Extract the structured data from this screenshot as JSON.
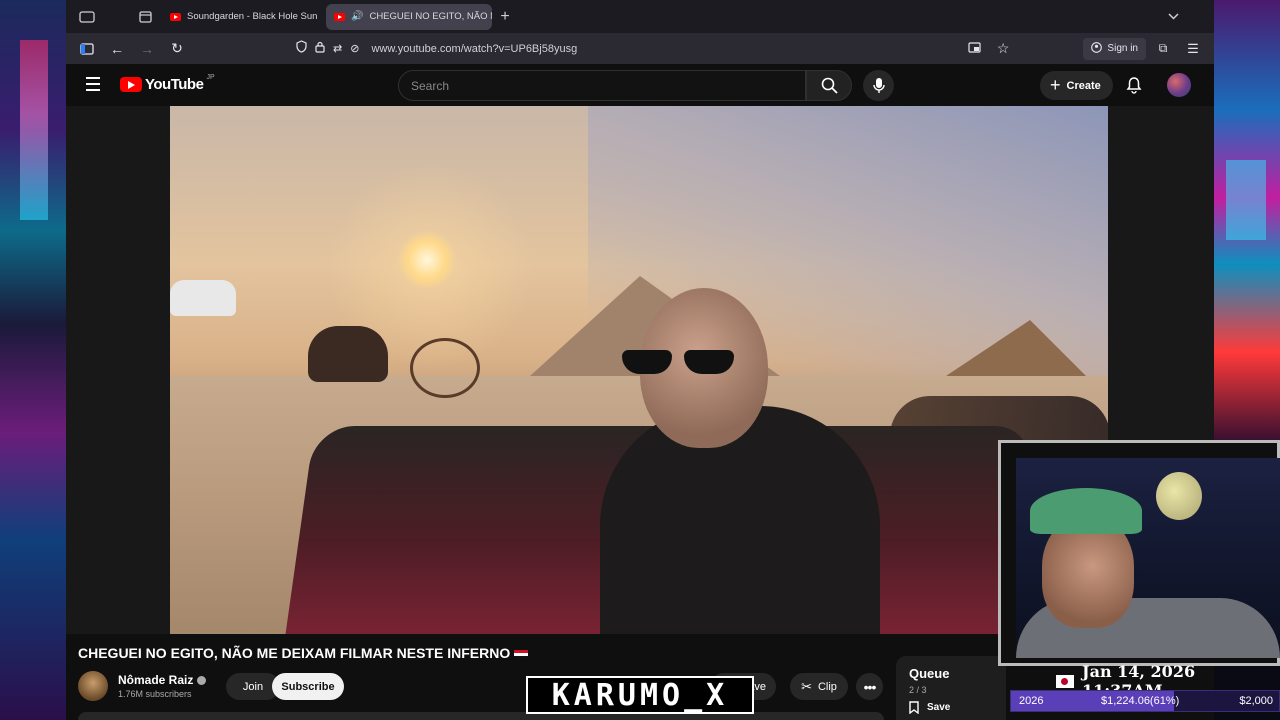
{
  "browser": {
    "tabs": [
      {
        "label": "Soundgarden - Black Hole Sun",
        "active": false
      },
      {
        "label": "CHEGUEI NO EGITO, NÃO M",
        "active": true
      }
    ],
    "url": "www.youtube.com/watch?v=UP6Bj58yusg",
    "signin_label": "Sign in"
  },
  "youtube": {
    "logo_text": "YouTube",
    "logo_region": "JP",
    "search_placeholder": "Search",
    "create_label": "Create"
  },
  "video": {
    "title": "CHEGUEI NO EGITO, NÃO ME DEIXAM FILMAR NESTE INFERNO",
    "channel_name": "Nômade Raiz",
    "subscribers": "1.76M subscribers",
    "join_label": "Join",
    "subscribe_label": "Subscribe",
    "save_label": "Save",
    "clip_label": "Clip"
  },
  "queue": {
    "title": "Queue",
    "count": "2 / 3",
    "save_label": "Save"
  },
  "overlay": {
    "watermark": "KARUMO_X",
    "datetime": "Jan 14, 2026 11:37AM",
    "goal_start": "2026",
    "goal_current": "$1,224.06(61%)",
    "goal_target": "$2,000",
    "goal_fraction": 0.61
  },
  "colors": {
    "youtube_red": "#ff0000",
    "background": "#0f0f0f",
    "progress_fill": "#5a3fb8"
  }
}
